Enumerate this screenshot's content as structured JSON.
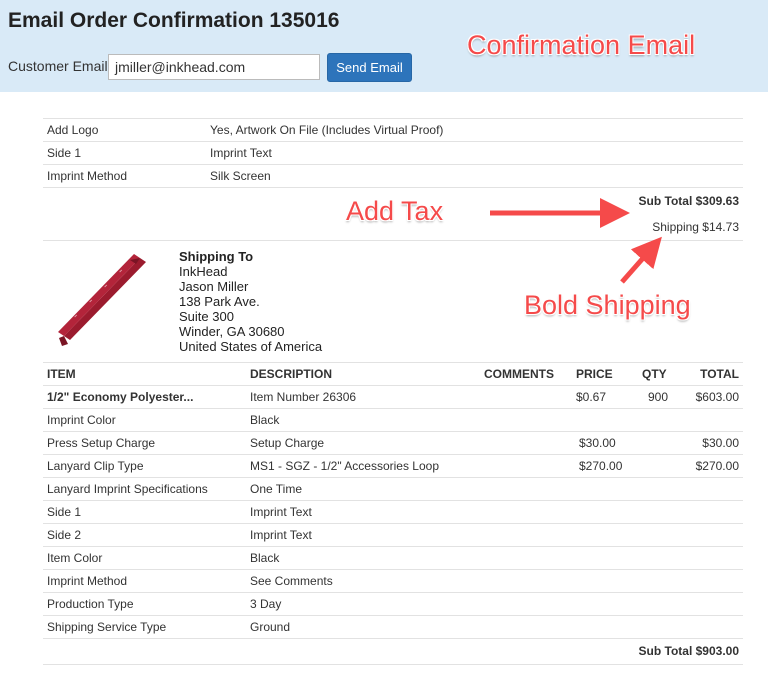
{
  "header": {
    "title": "Email Order Confirmation 135016",
    "email_label": "Customer Email:",
    "email_value": "jmiller@inkhead.com",
    "send_label": "Send Email"
  },
  "annotations": {
    "confirmation_email": "Confirmation Email",
    "add_tax": "Add Tax",
    "bold_shipping": "Bold Shipping"
  },
  "top_options": [
    {
      "label": "Add Logo",
      "value": "Yes, Artwork On File (Includes Virtual Proof)"
    },
    {
      "label": "Side 1",
      "value": "Imprint Text"
    },
    {
      "label": "Imprint Method",
      "value": "Silk Screen"
    }
  ],
  "totals_top": {
    "subtotal": "Sub Total $309.63",
    "shipping": "Shipping $14.73"
  },
  "shipping_to": {
    "heading": "Shipping To",
    "lines": [
      "InkHead",
      "Jason Miller",
      "138 Park Ave.",
      "Suite 300",
      "Winder, GA 30680",
      "United States of America"
    ]
  },
  "table": {
    "headers": {
      "item": "ITEM",
      "description": "DESCRIPTION",
      "comments": "COMMENTS",
      "price": "PRICE",
      "qty": "QTY",
      "total": "TOTAL"
    },
    "rows": [
      {
        "item": "1/2\" Economy Polyester...",
        "description": "Item Number 26306",
        "comments": "",
        "price": "$0.67",
        "qty": "900",
        "total": "$603.00"
      },
      {
        "item": "Imprint Color",
        "description": "Black",
        "comments": "",
        "price": "",
        "qty": "",
        "total": ""
      },
      {
        "item": "Press Setup Charge",
        "description": "Setup Charge",
        "comments": "",
        "price": "$30.00",
        "qty": "",
        "total": "$30.00"
      },
      {
        "item": "Lanyard Clip Type",
        "description": "MS1 - SGZ - 1/2\" Accessories Loop",
        "comments": "",
        "price": "$270.00",
        "qty": "",
        "total": "$270.00"
      },
      {
        "item": "Lanyard Imprint Specifications",
        "description": "One Time",
        "comments": "",
        "price": "",
        "qty": "",
        "total": ""
      },
      {
        "item": "Side 1",
        "description": "Imprint Text",
        "comments": "",
        "price": "",
        "qty": "",
        "total": ""
      },
      {
        "item": "Side 2",
        "description": "Imprint Text",
        "comments": "",
        "price": "",
        "qty": "",
        "total": ""
      },
      {
        "item": "Item Color",
        "description": "Black",
        "comments": "",
        "price": "",
        "qty": "",
        "total": ""
      },
      {
        "item": "Imprint Method",
        "description": "See Comments",
        "comments": "",
        "price": "",
        "qty": "",
        "total": ""
      },
      {
        "item": "Production Type",
        "description": "3 Day",
        "comments": "",
        "price": "",
        "qty": "",
        "total": ""
      },
      {
        "item": "Shipping Service Type",
        "description": "Ground",
        "comments": "",
        "price": "",
        "qty": "",
        "total": ""
      }
    ]
  },
  "totals_bottom": {
    "subtotal": "Sub Total $903.00"
  },
  "colors": {
    "header_bg": "#d9eaf7",
    "button": "#2d74bb",
    "annotation": "#f54a4a",
    "lanyard": "#9b1b2e"
  },
  "icons": {
    "lanyard_image": "lanyard-product-image",
    "arrow": "red-arrow"
  }
}
